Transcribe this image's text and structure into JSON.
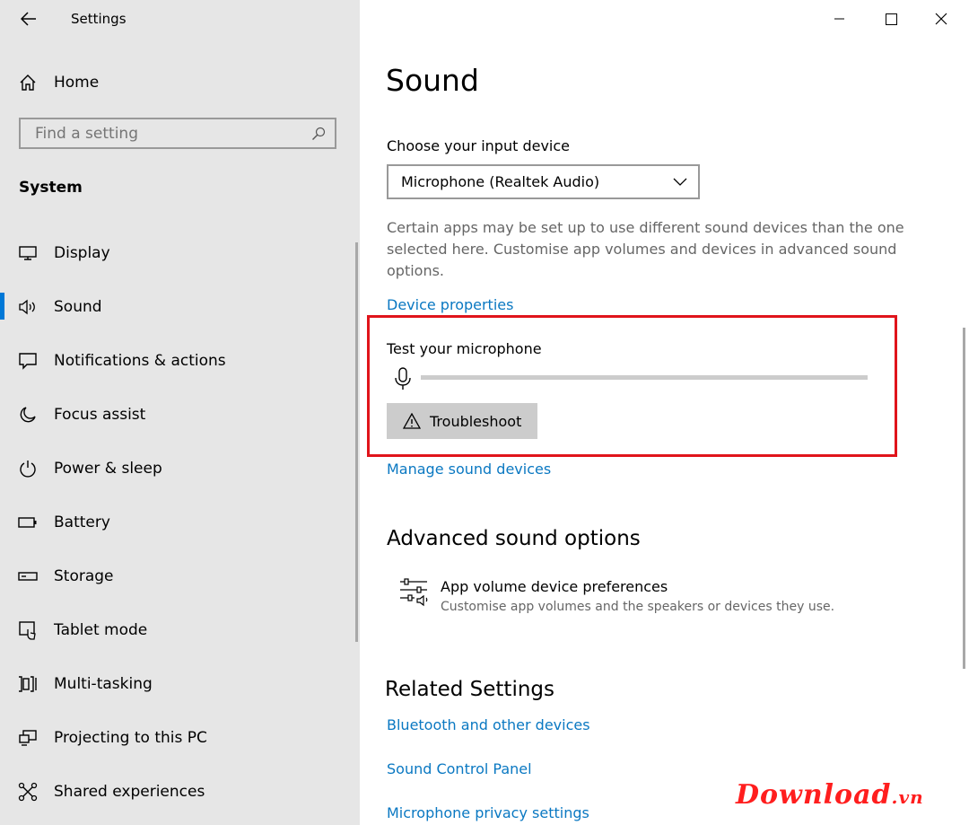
{
  "window": {
    "title": "Settings"
  },
  "sidebar": {
    "home_label": "Home",
    "search_placeholder": "Find a setting",
    "section_title": "System",
    "items": [
      {
        "label": "Display",
        "icon": "display-icon"
      },
      {
        "label": "Sound",
        "icon": "speaker-icon",
        "selected": true
      },
      {
        "label": "Notifications & actions",
        "icon": "notification-icon"
      },
      {
        "label": "Focus assist",
        "icon": "moon-icon"
      },
      {
        "label": "Power & sleep",
        "icon": "power-icon"
      },
      {
        "label": "Battery",
        "icon": "battery-icon"
      },
      {
        "label": "Storage",
        "icon": "storage-icon"
      },
      {
        "label": "Tablet mode",
        "icon": "tablet-mode-icon"
      },
      {
        "label": "Multi-tasking",
        "icon": "multitasking-icon"
      },
      {
        "label": "Projecting to this PC",
        "icon": "projecting-icon"
      },
      {
        "label": "Shared experiences",
        "icon": "shared-experiences-icon"
      }
    ]
  },
  "main": {
    "page_title": "Sound",
    "input": {
      "choose_label": "Choose your input device",
      "selected_device": "Microphone (Realtek Audio)",
      "description": "Certain apps may be set up to use different sound devices than the one selected here. Customise app volumes and devices in advanced sound options.",
      "device_properties_link": "Device properties",
      "test_label": "Test your microphone",
      "mic_level": 0,
      "troubleshoot_label": "Troubleshoot",
      "manage_link": "Manage sound devices"
    },
    "advanced": {
      "title": "Advanced sound options",
      "app_volume_title": "App volume  device preferences",
      "app_volume_desc": "Customise app volumes and the speakers or devices they use."
    },
    "related": {
      "title": "Related Settings",
      "links": [
        "Bluetooth and other devices",
        "Sound Control Panel",
        "Microphone privacy settings"
      ]
    }
  },
  "watermark": {
    "text": "Download",
    "suffix": ".vn"
  },
  "colors": {
    "accent": "#0078d7",
    "link": "#0a78c2",
    "highlight_box": "#e0141b",
    "sidebar_bg": "#e6e6e6"
  }
}
